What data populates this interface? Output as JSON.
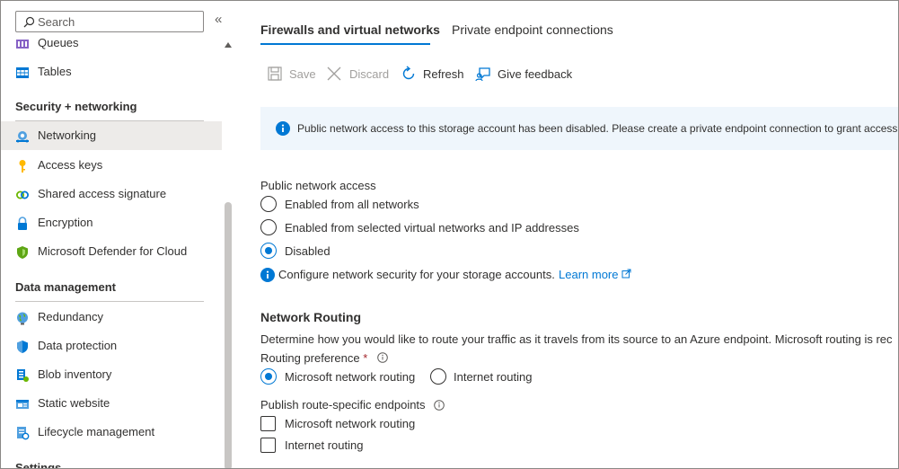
{
  "colors": {
    "accent": "#0078d4",
    "active_bg": "#edebe9",
    "banner_bg": "#eff6fc",
    "required": "#a4262c"
  },
  "sidebar": {
    "search_placeholder": "Search",
    "collapse_glyph": "«",
    "items_top": [
      {
        "label": "Queues",
        "icon": "queues-icon"
      },
      {
        "label": "Tables",
        "icon": "tables-icon"
      }
    ],
    "security_section": {
      "title": "Security + networking",
      "items": [
        {
          "label": "Networking",
          "icon": "networking-icon",
          "active": true
        },
        {
          "label": "Access keys",
          "icon": "key-icon"
        },
        {
          "label": "Shared access signature",
          "icon": "link-icon"
        },
        {
          "label": "Encryption",
          "icon": "lock-icon"
        },
        {
          "label": "Microsoft Defender for Cloud",
          "icon": "shield-icon"
        }
      ]
    },
    "data_section": {
      "title": "Data management",
      "items": [
        {
          "label": "Redundancy",
          "icon": "globe-icon"
        },
        {
          "label": "Data protection",
          "icon": "data-protection-icon"
        },
        {
          "label": "Blob inventory",
          "icon": "inventory-icon"
        },
        {
          "label": "Static website",
          "icon": "website-icon"
        },
        {
          "label": "Lifecycle management",
          "icon": "lifecycle-icon"
        }
      ]
    },
    "settings_section": {
      "title": "Settings"
    }
  },
  "main": {
    "tabs": [
      {
        "label": "Firewalls and virtual networks",
        "active": true
      },
      {
        "label": "Private endpoint connections",
        "active": false
      }
    ],
    "toolbar": {
      "save": "Save",
      "discard": "Discard",
      "refresh": "Refresh",
      "feedback": "Give feedback"
    },
    "banner": {
      "text": "Public network access to this storage account has been disabled. Please create a private endpoint connection to grant access."
    },
    "public_access": {
      "label": "Public network access",
      "options": [
        {
          "label": "Enabled from all networks",
          "checked": false
        },
        {
          "label": "Enabled from selected virtual networks and IP addresses",
          "checked": false
        },
        {
          "label": "Disabled",
          "checked": true
        }
      ],
      "info_text": "Configure network security for your storage accounts.",
      "learn_more": "Learn more"
    },
    "routing": {
      "heading": "Network Routing",
      "description": "Determine how you would like to route your traffic as it travels from its source to an Azure endpoint. Microsoft routing is rec",
      "preference_label": "Routing preference",
      "required_mark": "*",
      "options": [
        {
          "label": "Microsoft network routing",
          "checked": true
        },
        {
          "label": "Internet routing",
          "checked": false
        }
      ],
      "publish_label": "Publish route-specific endpoints",
      "checkboxes": [
        {
          "label": "Microsoft network routing",
          "checked": false
        },
        {
          "label": "Internet routing",
          "checked": false
        }
      ]
    }
  }
}
